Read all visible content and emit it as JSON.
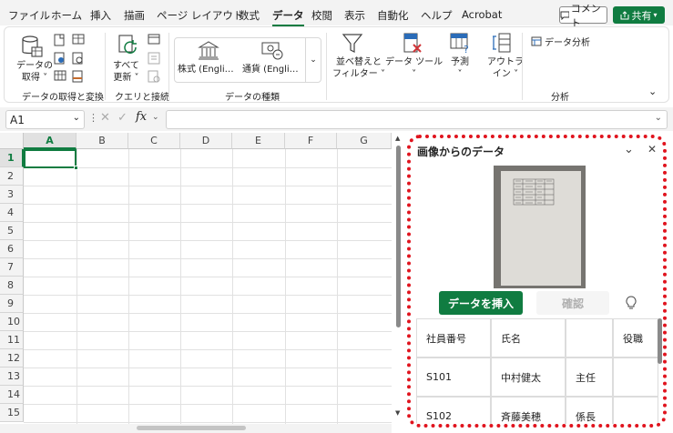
{
  "menu": {
    "tabs": [
      "ファイル",
      "ホーム",
      "挿入",
      "描画",
      "ページ レイアウト",
      "数式",
      "データ",
      "校閲",
      "表示",
      "自動化",
      "ヘルプ",
      "Acrobat"
    ],
    "active_tab": "データ",
    "comment_label": "コメント",
    "share_label": "共有"
  },
  "ribbon": {
    "get_data": {
      "label_line1": "データの",
      "label_line2": "取得"
    },
    "get_transform_group": "データの取得と変換",
    "refresh_all": {
      "label_line1": "すべて",
      "label_line2": "更新"
    },
    "queries_group": "クエリと接続",
    "stocks_label": "株式 (Engli…",
    "currencies_label": "通貨 (Engli…",
    "data_types_group": "データの種類",
    "sort_filter": {
      "label_line1": "並べ替えと",
      "label_line2": "フィルター"
    },
    "data_tools_label": "データ ツール",
    "forecast_label": "予測",
    "outline": {
      "label_line1": "アウトラ",
      "label_line2": "イン"
    },
    "data_analysis_label": "データ分析",
    "analysis_group": "分析"
  },
  "formula_bar": {
    "name_box": "A1",
    "formula": ""
  },
  "grid": {
    "columns": [
      "A",
      "B",
      "C",
      "D",
      "E",
      "F",
      "G"
    ],
    "rows": [
      "1",
      "2",
      "3",
      "4",
      "5",
      "6",
      "7",
      "8",
      "9",
      "10",
      "11",
      "12",
      "13",
      "14",
      "15"
    ],
    "selected_cell": "A1"
  },
  "panel": {
    "title": "画像からのデータ",
    "insert_label": "データを挿入",
    "confirm_label": "確認",
    "table": [
      [
        "社員番号",
        "氏名",
        "",
        "役職"
      ],
      [
        "S101",
        "中村健太",
        "主任",
        ""
      ],
      [
        "S102",
        "斉藤美穂",
        "係長",
        ""
      ]
    ]
  },
  "colors": {
    "accent": "#107c41",
    "highlight": "#e0141e"
  }
}
